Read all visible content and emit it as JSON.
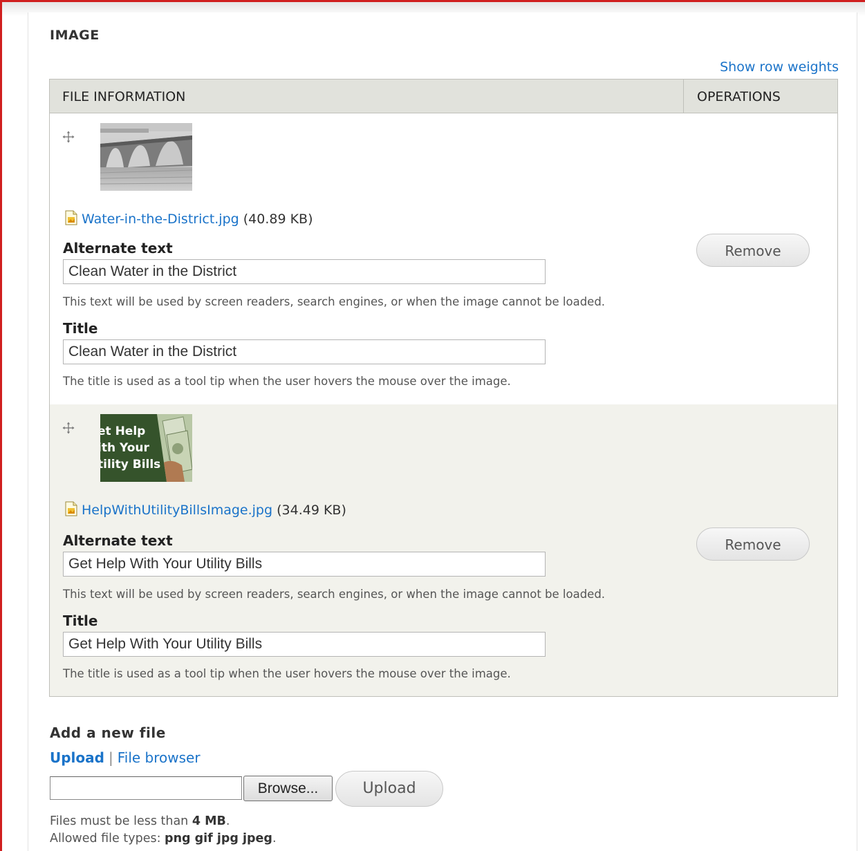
{
  "section": {
    "title": "IMAGE",
    "show_weights": "Show row weights"
  },
  "table": {
    "col_file_info": "FILE INFORMATION",
    "col_operations": "OPERATIONS"
  },
  "rows": [
    {
      "filename": "Water-in-the-District.jpg",
      "filesize": "(40.89 KB)",
      "alt_label": "Alternate text",
      "alt_value": "Clean Water in the District",
      "alt_help": "This text will be used by screen readers, search engines, or when the image cannot be loaded.",
      "title_label": "Title",
      "title_value": "Clean Water in the District",
      "title_help": "The title is used as a tool tip when the user hovers the mouse over the image.",
      "remove_label": "Remove"
    },
    {
      "filename": "HelpWithUtilityBillsImage.jpg",
      "filesize": "(34.49 KB)",
      "thumb_text": [
        "et Help",
        "ith Your",
        "tility Bills"
      ],
      "alt_label": "Alternate text",
      "alt_value": "Get Help With Your Utility Bills",
      "alt_help": "This text will be used by screen readers, search engines, or when the image cannot be loaded.",
      "title_label": "Title",
      "title_value": "Get Help With Your Utility Bills",
      "title_help": "The title is used as a tool tip when the user hovers the mouse over the image.",
      "remove_label": "Remove"
    }
  ],
  "add_file": {
    "title": "Add a new file",
    "upload_link": "Upload",
    "separator": "|",
    "browser_link": "File browser",
    "browse_button": "Browse...",
    "upload_button": "Upload",
    "size_note_prefix": "Files must be less than ",
    "size_value": "4 MB",
    "size_note_suffix": ".",
    "types_note_prefix": "Allowed file types: ",
    "types_value": "png gif jpg jpeg",
    "types_note_suffix": "."
  },
  "colors": {
    "link": "#1a73c9",
    "header_bg": "#e1e2dc",
    "alt_row_bg": "#f2f2ec",
    "frame": "#d01f1f"
  }
}
